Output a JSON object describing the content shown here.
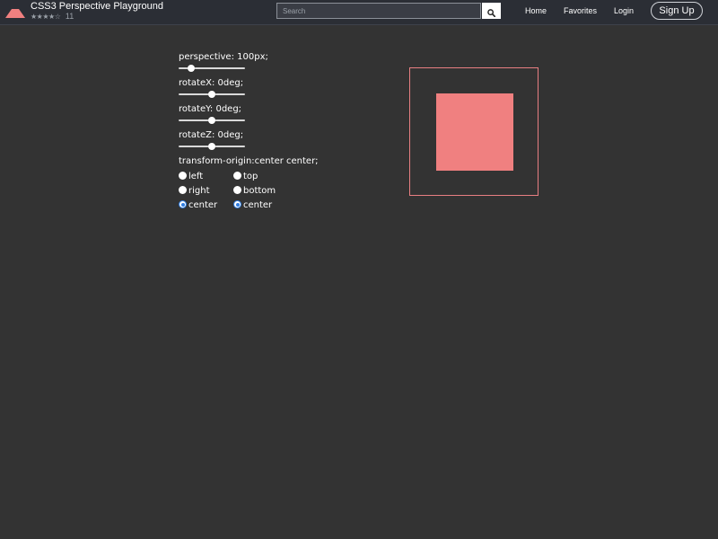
{
  "header": {
    "title": "CSS3 Perspective Playground",
    "rating_stars": "★★★★☆",
    "rating_value": 4,
    "rating_count": "11",
    "logo_icon": "pyramid-logo-icon",
    "search": {
      "placeholder": "Search",
      "value": ""
    },
    "search_icon": "magnifier-icon",
    "nav": [
      {
        "label": "Home"
      },
      {
        "label": "Favorites"
      },
      {
        "label": "Login"
      }
    ],
    "signup_label": "Sign Up"
  },
  "controls": {
    "perspective": {
      "label": "perspective: 100px;",
      "value": 100,
      "min": 0,
      "max": 999
    },
    "rotateX": {
      "label": "rotateX: 0deg;",
      "value": 0,
      "min": -180,
      "max": 180
    },
    "rotateY": {
      "label": "rotateY: 0deg;",
      "value": 0,
      "min": -180,
      "max": 180
    },
    "rotateZ": {
      "label": "rotateZ: 0deg;",
      "value": 0,
      "min": -180,
      "max": 180
    },
    "origin_label": "transform-origin:center center;",
    "origin_x": [
      {
        "label": "left",
        "checked": false
      },
      {
        "label": "right",
        "checked": false
      },
      {
        "label": "center",
        "checked": true
      }
    ],
    "origin_y": [
      {
        "label": "top",
        "checked": false
      },
      {
        "label": "bottom",
        "checked": false
      },
      {
        "label": "center",
        "checked": true
      }
    ]
  },
  "colors": {
    "background": "#333333",
    "header_bg": "#2b2e35",
    "box_fill": "#f08080",
    "stage_border": "#e87f82",
    "radio_accent": "#2f7de1"
  }
}
